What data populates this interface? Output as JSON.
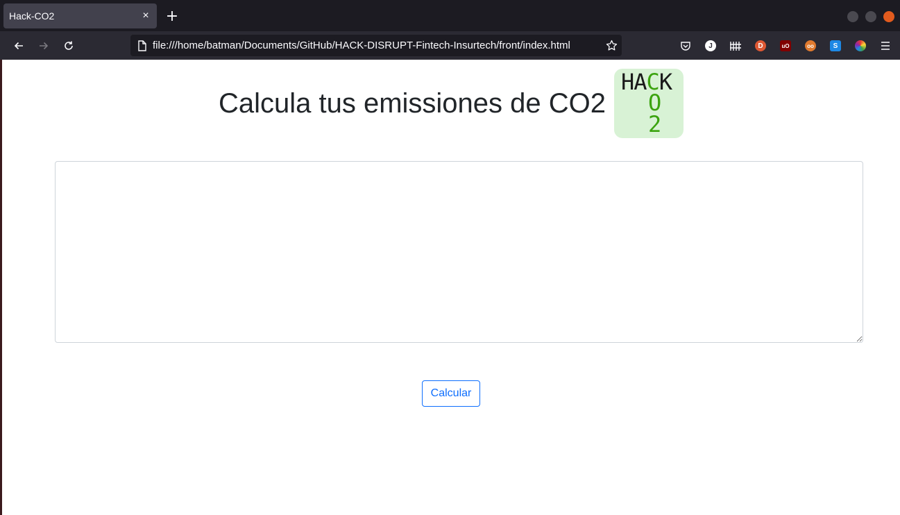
{
  "browser": {
    "tab_title": "Hack-CO2",
    "tab_close_glyph": "×",
    "new_tab_glyph": "+",
    "url": "file:///home/batman/Documents/GitHub/HACK-DISRUPT-Fintech-Insurtech/front/index.html",
    "toolbar_icons": [
      "pocket-icon",
      "joplin-icon",
      "library-icon",
      "duckduckgo-icon",
      "ublock-origin-icon",
      "privacy-badger-icon",
      "s-extension-icon",
      "color-picker-icon",
      "menu-icon"
    ],
    "accent_close": "#e25b1e"
  },
  "page": {
    "title": "Calcula tus emissiones de CO2",
    "logo": {
      "line1_prefix": "HA",
      "line1_accent": "C",
      "line1_suffix": "K",
      "line2": "O",
      "line3": "2",
      "background": "#d8f2d5",
      "accent_color": "#3ba30f"
    },
    "textarea_value": "",
    "calculate_button": "Calcular",
    "button_color": "#0d6efd"
  }
}
